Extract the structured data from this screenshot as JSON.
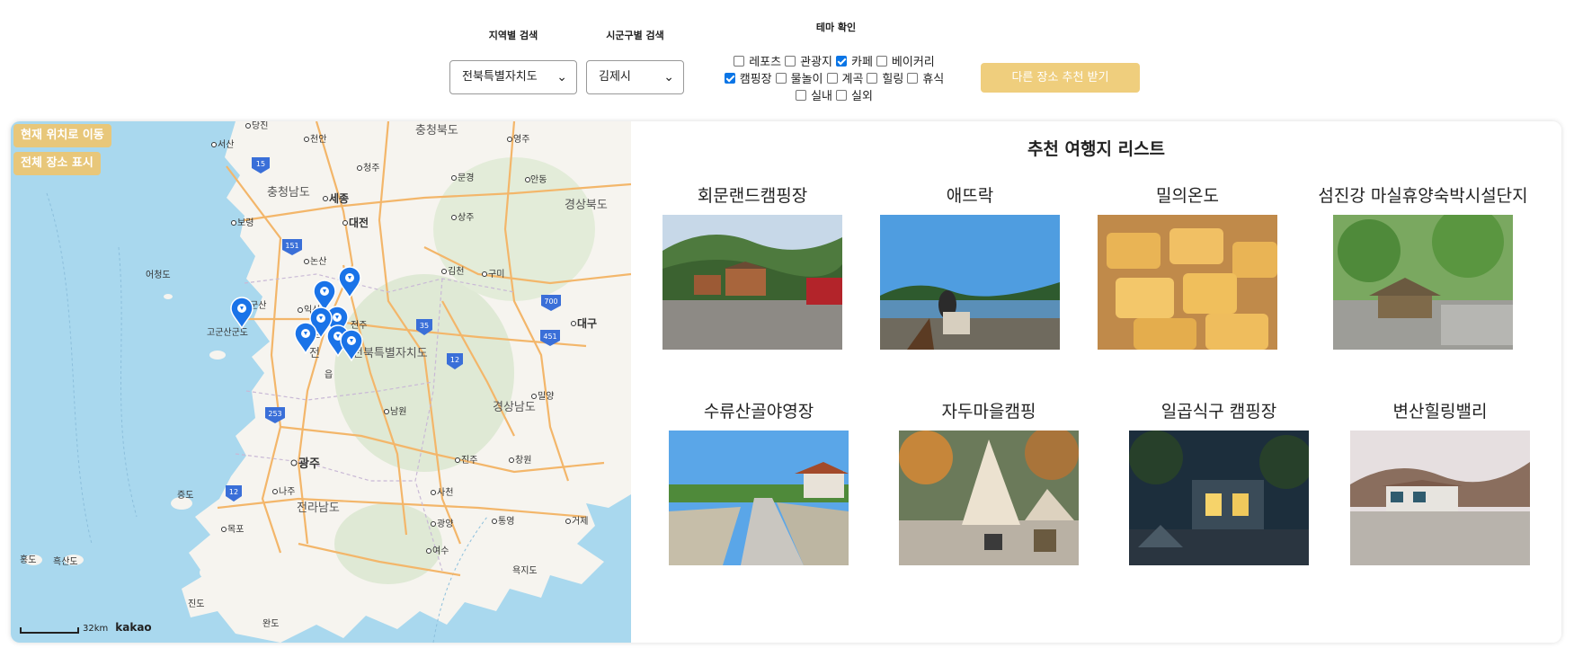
{
  "filters": {
    "region_label": "지역별 검색",
    "region_value": "전북특별자치도",
    "city_label": "시군구별 검색",
    "city_value": "김제시",
    "theme_label": "테마 확인",
    "themes": [
      {
        "label": "레포츠",
        "checked": false
      },
      {
        "label": "관광지",
        "checked": false
      },
      {
        "label": "카페",
        "checked": true
      },
      {
        "label": "베이커리",
        "checked": false
      },
      {
        "label": "캠핑장",
        "checked": true
      },
      {
        "label": "물놀이",
        "checked": false
      },
      {
        "label": "계곡",
        "checked": false
      },
      {
        "label": "힐링",
        "checked": false
      },
      {
        "label": "휴식",
        "checked": false
      },
      {
        "label": "실내",
        "checked": false
      },
      {
        "label": "실외",
        "checked": false
      }
    ],
    "recommend_button": "다른 장소 추천 받기"
  },
  "map": {
    "current_location_button": "현재 위치로 이동",
    "show_all_button": "전체 장소 표시",
    "scale_label": "32km",
    "logo": "kakao",
    "labels": {
      "dangjin": "당진",
      "seosan": "서산",
      "cheonan": "천안",
      "chungbuk": "충청북도",
      "yeongju": "영주",
      "chungnam": "충청남도",
      "cheongju": "청주",
      "andong": "안동",
      "mungyeong": "문경",
      "sejong": "세종",
      "gyeongbuk": "경상북도",
      "boryeong": "보령",
      "daejeon": "대전",
      "sangju": "상주",
      "eocheongdo": "어청도",
      "nonsan": "논산",
      "gimcheon": "김천",
      "gumi": "구미",
      "gunsan": "군산",
      "iksan": "익산",
      "gogunsan": "고군산군도",
      "jeonju": "전주",
      "daegu": "대구",
      "jeonbuk": "전북특별자치도",
      "miryang": "밀양",
      "namwon": "남원",
      "gyeongnam": "경상남도",
      "changwon": "창원",
      "jinju": "진주",
      "gwangju": "광주",
      "jeungdo": "증도",
      "naju": "나주",
      "sacheon": "사천",
      "jeonnam": "전라남도",
      "gwangyang": "광양",
      "tongyeong": "통영",
      "geoje": "거제",
      "mokpo": "목포",
      "yeosu": "여수",
      "hongdo": "홍도",
      "heuksando": "흑산도",
      "yokjido": "욕지도",
      "jindo": "진도",
      "wando": "완도",
      "gim": "김",
      "jeon": "전",
      "eup": "읍",
      "rd15": "15",
      "rd151": "151",
      "rd700": "700",
      "rd35": "35",
      "rd451": "451",
      "rd12": "12",
      "rd12b": "12",
      "rd253": "253"
    }
  },
  "list": {
    "title": "추천 여행지 리스트",
    "items": [
      {
        "name": "회문랜드캠핑장"
      },
      {
        "name": "애뜨락"
      },
      {
        "name": "밀의온도"
      },
      {
        "name": "섬진강 마실휴양숙박시설단지"
      },
      {
        "name": "수류산골야영장"
      },
      {
        "name": "자두마을캠핑"
      },
      {
        "name": "일곱식구 캠핑장"
      },
      {
        "name": "변산힐링밸리"
      }
    ]
  }
}
